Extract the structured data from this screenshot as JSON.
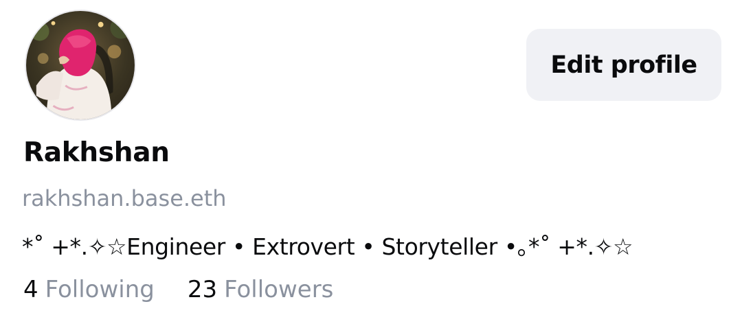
{
  "profile": {
    "display_name": "Rakhshan",
    "handle": "rakhshan.base.eth",
    "bio": "*˚ +*.✧☆Engineer • Extrovert • Storyteller •｡*˚ +*.✧☆",
    "edit_button_label": "Edit profile"
  },
  "stats": {
    "following_count": "4",
    "following_label": "Following",
    "followers_count": "23",
    "followers_label": "Followers"
  },
  "colors": {
    "text_primary": "#0a0b0d",
    "text_secondary": "#8a919e",
    "button_bg": "#f0f1f5",
    "avatar_accent": "#e0246e"
  },
  "icons": {
    "avatar": "user-avatar-photo"
  }
}
